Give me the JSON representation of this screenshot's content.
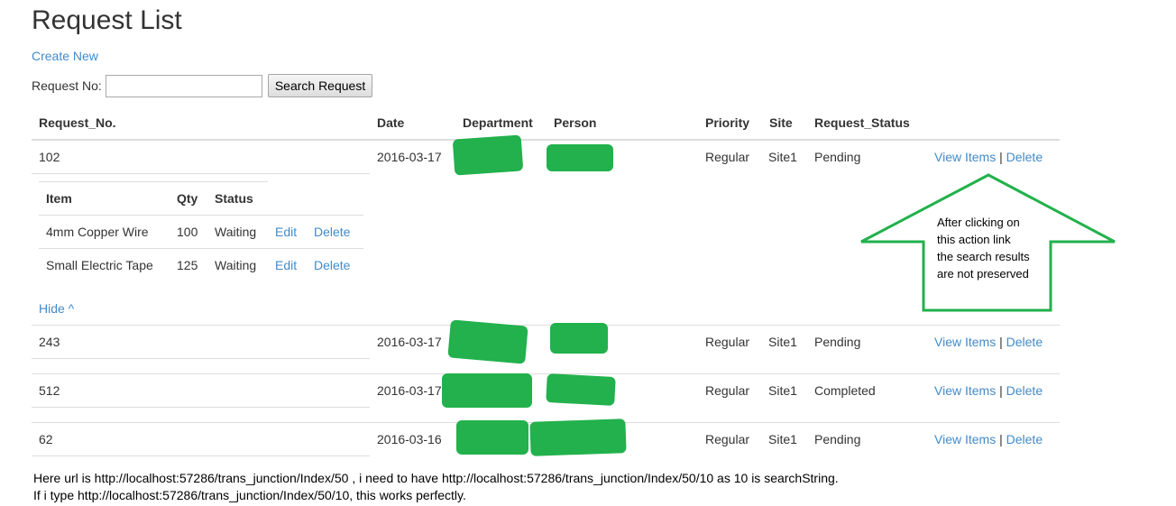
{
  "page": {
    "title": "Request List",
    "create_new": "Create New",
    "search_label": "Request No:",
    "search_value": "",
    "search_placeholder": "",
    "search_button": "Search Request"
  },
  "columns": [
    "Request_No.",
    "Date",
    "Department",
    "Person",
    "Priority",
    "Site",
    "Request_Status"
  ],
  "rows": [
    {
      "no": "102",
      "date": "2016-03-17",
      "priority": "Regular",
      "site": "Site1",
      "status": "Pending",
      "view": "View Items",
      "sep": "|",
      "delete": "Delete"
    },
    {
      "no": "243",
      "date": "2016-03-17",
      "priority": "Regular",
      "site": "Site1",
      "status": "Pending",
      "view": "View Items",
      "sep": "|",
      "delete": "Delete"
    },
    {
      "no": "512",
      "date": "2016-03-17",
      "priority": "Regular",
      "site": "Site1",
      "status": "Completed",
      "view": "View Items",
      "sep": "|",
      "delete": "Delete"
    },
    {
      "no": "62",
      "date": "2016-03-16",
      "priority": "Regular",
      "site": "Site1",
      "status": "Pending",
      "view": "View Items",
      "sep": "|",
      "delete": "Delete"
    }
  ],
  "items_table": {
    "columns": [
      "Item",
      "Qty",
      "Status"
    ],
    "rows": [
      {
        "item": "4mm Copper Wire",
        "qty": "100",
        "status": "Waiting",
        "edit": "Edit",
        "delete": "Delete"
      },
      {
        "item": "Small Electric Tape",
        "qty": "125",
        "status": "Waiting",
        "edit": "Edit",
        "delete": "Delete"
      }
    ],
    "hide": "Hide ^"
  },
  "annotation": {
    "lines": [
      "After clicking on",
      "this action link",
      "the search results",
      "are not preserved"
    ],
    "arrow_color": "#22b14c"
  },
  "notes": [
    "Here url is http://localhost:57286/trans_junction/Index/50 ,  i need to have http://localhost:57286/trans_junction/Index/50/10 as 10 is searchString.",
    "If i type  http://localhost:57286/trans_junction/Index/50/10, this works perfectly."
  ]
}
